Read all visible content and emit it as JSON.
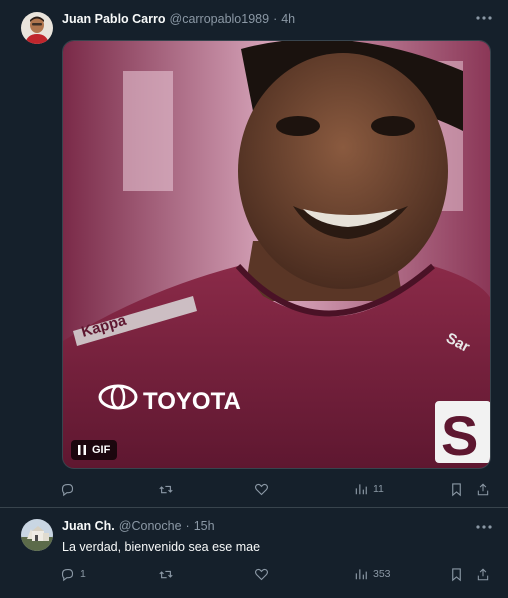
{
  "tweets": [
    {
      "author": {
        "name": "Juan Pablo Carro",
        "handle": "@carropablo1989"
      },
      "separator": "·",
      "time": "4h",
      "media": {
        "type": "gif",
        "badge_label": "GIF",
        "jersey_sponsor": "TOYOTA",
        "jersey_brand": "Kappa",
        "jersey_crest": "S",
        "jersey_side_text": "Sar"
      },
      "actions": {
        "reply_count": "",
        "retweet_count": "",
        "like_count": "",
        "views_count": "11"
      }
    },
    {
      "author": {
        "name": "Juan Ch.",
        "handle": "@Conoche"
      },
      "separator": "·",
      "time": "15h",
      "text": "La verdad, bienvenido sea ese mae",
      "actions": {
        "reply_count": "1",
        "retweet_count": "",
        "like_count": "",
        "views_count": "353"
      }
    }
  ],
  "icons": {
    "more": "more-horizontal-icon",
    "reply": "reply-icon",
    "retweet": "retweet-icon",
    "like": "heart-icon",
    "views": "analytics-icon",
    "bookmark": "bookmark-icon",
    "share": "share-icon",
    "pause": "pause-icon"
  },
  "colors": {
    "background": "#15202b",
    "border": "#38444d",
    "text_primary": "#f7f9f9",
    "text_secondary": "#8b98a5",
    "jersey": "#7a2340"
  }
}
